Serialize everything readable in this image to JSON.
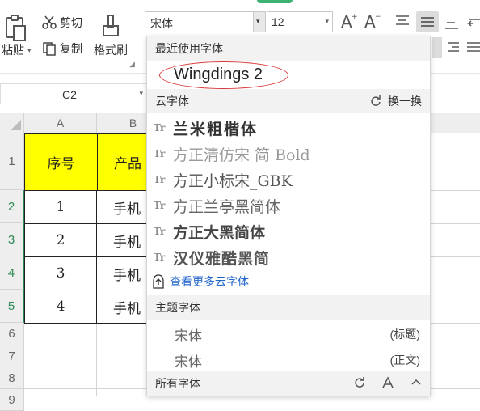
{
  "ribbon": {
    "paste_label": "粘贴",
    "cut_label": "剪切",
    "copy_label": "复制",
    "format_painter_label": "格式刷",
    "font_name": "宋体",
    "font_size": "12"
  },
  "name_box": "C2",
  "sheet": {
    "columns": [
      "A",
      "B"
    ],
    "rows": [
      "1",
      "2",
      "3",
      "4",
      "5",
      "6",
      "7",
      "8",
      "9"
    ],
    "header": [
      "序号",
      "产品"
    ],
    "data": [
      [
        "1",
        "手机"
      ],
      [
        "2",
        "手机"
      ],
      [
        "3",
        "手机"
      ],
      [
        "4",
        "手机"
      ]
    ]
  },
  "font_dropdown": {
    "recent_title": "最近使用字体",
    "recent_font": "Wingdings 2",
    "cloud_title": "云字体",
    "swap_label": "换一换",
    "cloud_icon_text": "Tr",
    "cloud_fonts": [
      "兰米粗楷体",
      "方正清仿宋 简 Bold",
      "方正小标宋_GBK",
      "方正兰亭黑简体",
      "方正大黑简体",
      "汉仪雅酷黑简"
    ],
    "more_label": "查看更多云字体",
    "theme_title": "主题字体",
    "theme_fonts": [
      {
        "name": "宋体",
        "tag": "(标题)"
      },
      {
        "name": "宋体",
        "tag": "(正文)"
      }
    ],
    "all_title": "所有字体"
  },
  "colors": {
    "header_fill": "#ffff00",
    "selection_green": "#2e8b57",
    "annotation_red": "#d83a3a",
    "link_blue": "#2266cc"
  }
}
